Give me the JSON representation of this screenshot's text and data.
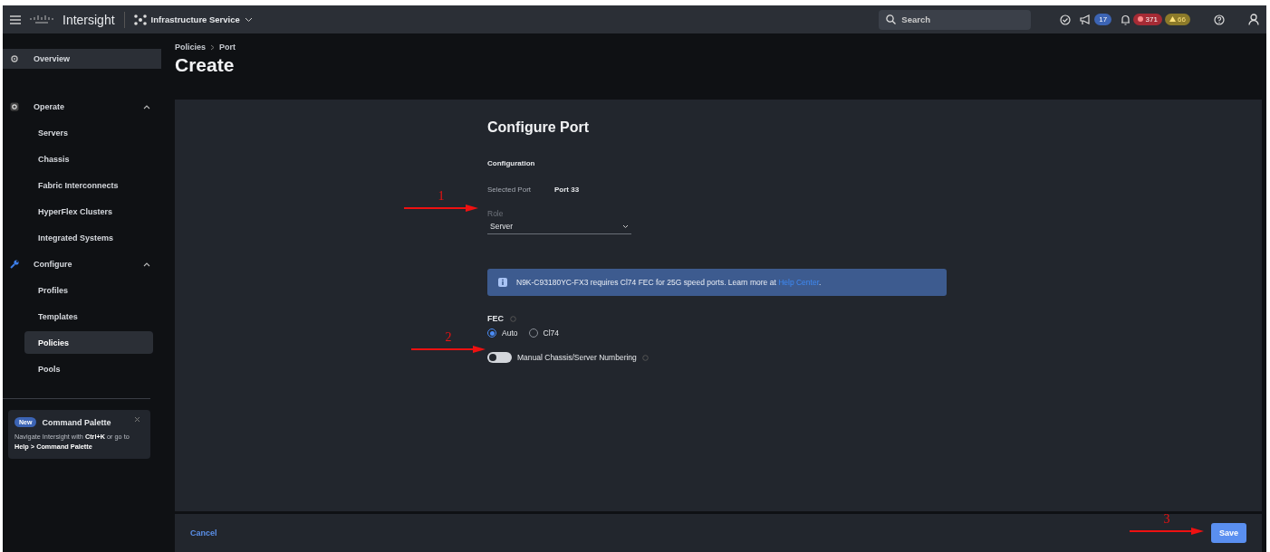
{
  "topbar": {
    "brand": "Intersight",
    "service": "Infrastructure Service",
    "search": {
      "placeholder": "Search"
    },
    "announcements_count": "17",
    "critical_count": "371",
    "warning_count": "66"
  },
  "sidebar": {
    "items": [
      {
        "label": "Overview",
        "kind": "link"
      },
      {
        "label": "Operate",
        "kind": "group",
        "expanded": true,
        "children": [
          {
            "label": "Servers",
            "selected": false
          },
          {
            "label": "Chassis",
            "selected": false
          },
          {
            "label": "Fabric Interconnects",
            "selected": false
          },
          {
            "label": "HyperFlex Clusters",
            "selected": false
          },
          {
            "label": "Integrated Systems",
            "selected": false
          }
        ]
      },
      {
        "label": "Configure",
        "kind": "group",
        "expanded": true,
        "children": [
          {
            "label": "Profiles",
            "selected": false
          },
          {
            "label": "Templates",
            "selected": false
          },
          {
            "label": "Policies",
            "selected": true
          },
          {
            "label": "Pools",
            "selected": false
          }
        ]
      }
    ]
  },
  "command_palette": {
    "badge": "New",
    "title": "Command Palette",
    "text": "Navigate Intersight with **Ctrl+K** or go to **Help > Command Palette**"
  },
  "breadcrumb": [
    "Policies",
    "Port"
  ],
  "title": "Create",
  "form": {
    "title": "Configure Port",
    "section": "Configuration",
    "selected_port_label": "Selected Port",
    "selected_port_value": "Port 33",
    "role": {
      "label": "Role",
      "value": "Server"
    },
    "alert": {
      "text": "N9K-C93180YC-FX3 requires Cl74 FEC for 25G speed ports. Learn more at ",
      "link": "Help Center",
      "end": "."
    },
    "fec": {
      "label": "FEC",
      "options": [
        {
          "label": "Auto",
          "selected": true
        },
        {
          "label": "Cl74",
          "selected": false
        }
      ]
    },
    "toggle": {
      "label": "Manual Chassis/Server Numbering",
      "on": false
    }
  },
  "footer": {
    "cancel": "Cancel",
    "save": "Save"
  },
  "annotations": [
    {
      "number": "1"
    },
    {
      "number": "2"
    },
    {
      "number": "3"
    }
  ]
}
